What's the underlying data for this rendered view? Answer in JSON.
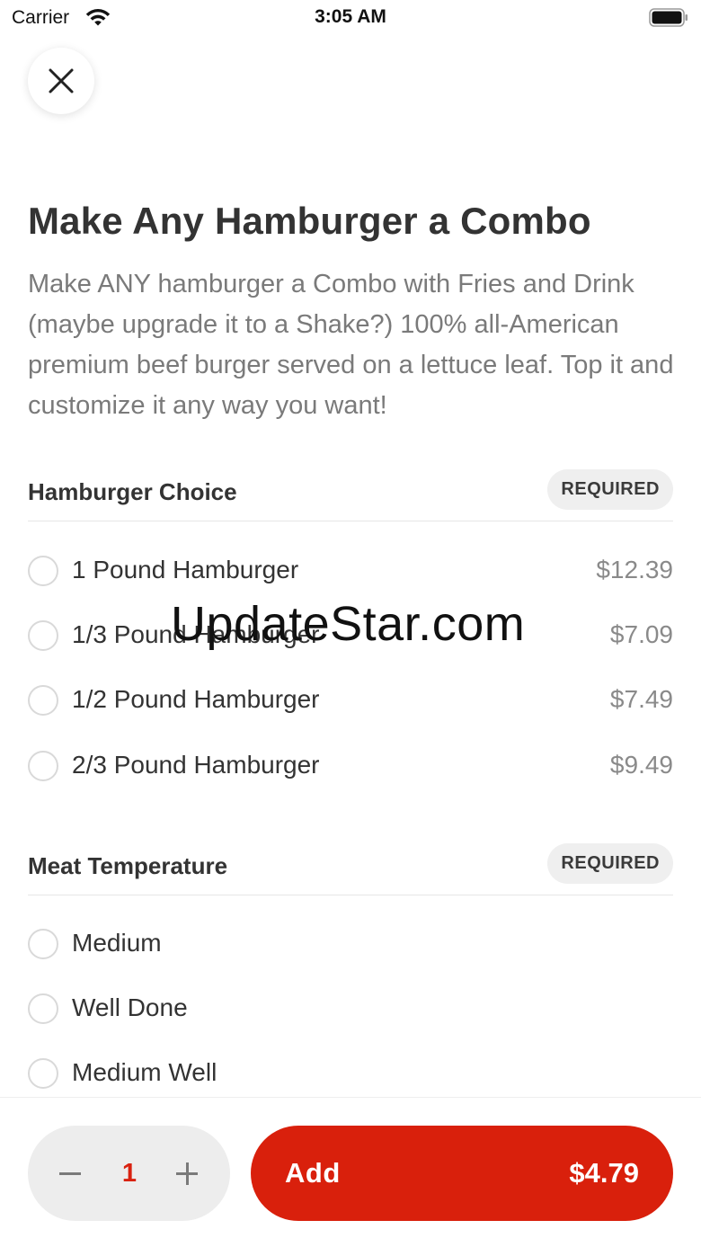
{
  "status_bar": {
    "carrier": "Carrier",
    "time": "3:05 AM"
  },
  "item": {
    "title": "Make Any Hamburger a Combo",
    "description": "Make ANY hamburger a Combo with Fries and Drink (maybe upgrade it to a Shake?) 100% all-American premium beef burger served on a lettuce leaf. Top it and customize it any way you want!"
  },
  "sections": [
    {
      "title": "Hamburger Choice",
      "badge": "REQUIRED",
      "options": [
        {
          "label": "1 Pound Hamburger",
          "price": "$12.39"
        },
        {
          "label": "1/3 Pound Hamburger",
          "price": "$7.09"
        },
        {
          "label": "1/2 Pound Hamburger",
          "price": "$7.49"
        },
        {
          "label": "2/3 Pound Hamburger",
          "price": "$9.49"
        }
      ]
    },
    {
      "title": "Meat Temperature",
      "badge": "REQUIRED",
      "options": [
        {
          "label": "Medium"
        },
        {
          "label": "Well Done"
        },
        {
          "label": "Medium Well"
        }
      ]
    }
  ],
  "watermark": "UpdateStar.com",
  "footer": {
    "quantity": "1",
    "add_label": "Add",
    "add_price": "$4.79"
  },
  "colors": {
    "accent": "#d9200c",
    "badge_bg": "#efefef"
  },
  "icons": {
    "close": "close-icon",
    "wifi": "wifi-icon",
    "battery": "battery-icon",
    "minus": "minus-icon",
    "plus": "plus-icon"
  }
}
